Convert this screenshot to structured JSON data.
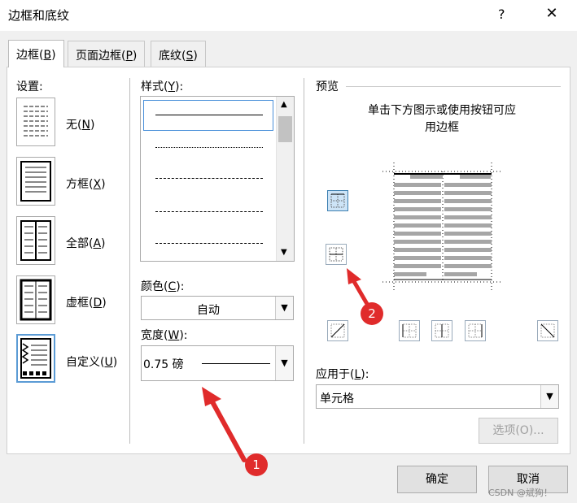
{
  "window": {
    "title": "边框和底纹",
    "help": "?",
    "close": "✕"
  },
  "tabs": [
    {
      "label": "边框(",
      "key": "B",
      "tail": ")"
    },
    {
      "label": "页面边框(",
      "key": "P",
      "tail": ")"
    },
    {
      "label": "底纹(",
      "key": "S",
      "tail": ")"
    }
  ],
  "settings": {
    "heading": "设置:",
    "items": [
      {
        "label": "无(",
        "key": "N",
        "tail": ")"
      },
      {
        "label": "方框(",
        "key": "X",
        "tail": ")"
      },
      {
        "label": "全部(",
        "key": "A",
        "tail": ")"
      },
      {
        "label": "虚框(",
        "key": "D",
        "tail": ")"
      },
      {
        "label": "自定义(",
        "key": "U",
        "tail": ")"
      }
    ]
  },
  "style": {
    "heading": "样式(",
    "key": "Y",
    "tail": "):"
  },
  "color": {
    "heading": "颜色(",
    "key": "C",
    "tail": "):",
    "value": "自动"
  },
  "width": {
    "heading": "宽度(",
    "key": "W",
    "tail": "):",
    "value": "0.75 磅"
  },
  "preview": {
    "heading": "预览",
    "hint1": "单击下方图示或使用按钮可应",
    "hint2": "用边框"
  },
  "apply": {
    "heading": "应用于(",
    "key": "L",
    "tail": "):",
    "value": "单元格"
  },
  "buttons": {
    "options": "选项(O)...",
    "ok": "确定",
    "cancel": "取消"
  },
  "annotations": {
    "one": "1",
    "two": "2",
    "color": "#e02b2b"
  },
  "watermark": "CSDN @斌狗！"
}
